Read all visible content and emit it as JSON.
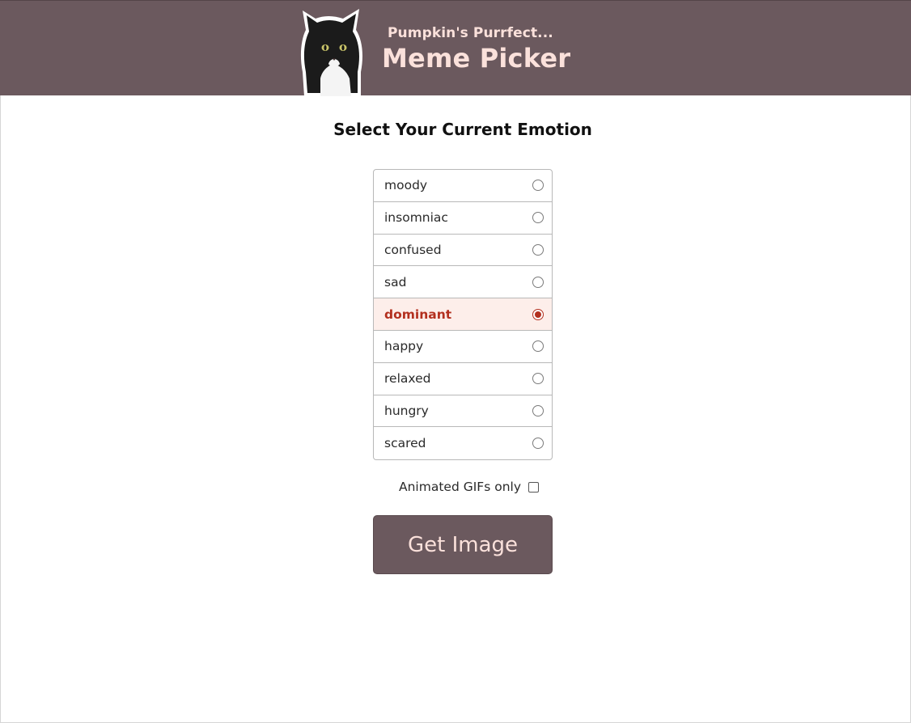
{
  "header": {
    "subtitle": "Pumpkin's Purrfect...",
    "title": "Meme Picker",
    "logo_icon": "cat-icon",
    "background_color": "#6b595e",
    "text_color": "#fbe1db"
  },
  "main": {
    "heading": "Select Your Current Emotion",
    "emotions": [
      {
        "label": "moody",
        "selected": false
      },
      {
        "label": "insomniac",
        "selected": false
      },
      {
        "label": "confused",
        "selected": false
      },
      {
        "label": "sad",
        "selected": false
      },
      {
        "label": "dominant",
        "selected": true
      },
      {
        "label": "happy",
        "selected": false
      },
      {
        "label": "relaxed",
        "selected": false
      },
      {
        "label": "hungry",
        "selected": false
      },
      {
        "label": "scared",
        "selected": false
      }
    ],
    "gifs_only_label": "Animated GIFs only",
    "gifs_only_checked": false,
    "get_image_label": "Get Image",
    "accent_color": "#b3301f"
  }
}
